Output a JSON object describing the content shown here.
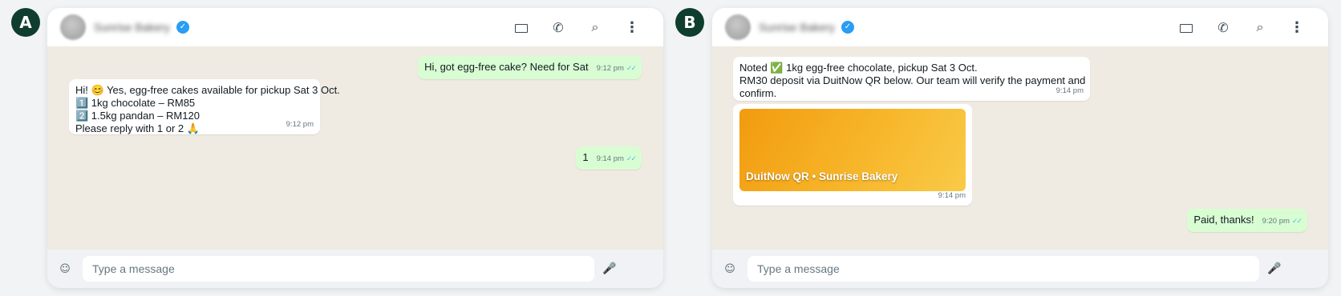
{
  "panels": [
    {
      "badge": "A",
      "contact_name": "Sunrise Bakery",
      "verified_icon": "✓",
      "header_icons": {
        "video": "",
        "call": "✆",
        "search": "⌕",
        "menu": "⋮"
      },
      "messages": [
        {
          "lines": [
            "Hi, got egg-free cake? Need for Sat"
          ],
          "time": "9:12 pm",
          "ticks": "✓✓"
        },
        {
          "lines": [
            "Hi! 😊 Yes, egg-free cakes available for pickup Sat 3 Oct.",
            "1️⃣ 1kg chocolate – RM85",
            "2️⃣ 1.5kg pandan – RM120",
            "Please reply with 1 or 2 🙏"
          ],
          "time": "9:12 pm"
        },
        {
          "lines": [
            "1"
          ],
          "time": "9:14 pm",
          "ticks": "✓✓"
        }
      ],
      "input_placeholder": "Type a message",
      "emoji_icon": "☺",
      "mic_icon": "🎤"
    },
    {
      "badge": "B",
      "contact_name": "Sunrise Bakery",
      "verified_icon": "✓",
      "header_icons": {
        "video": "",
        "call": "✆",
        "search": "⌕",
        "menu": "⋮"
      },
      "messages": [
        {
          "lines": [
            "Noted ✅ 1kg egg-free chocolate, pickup Sat 3 Oct.",
            "RM30 deposit via DuitNow QR below. Our team will verify the payment and",
            "confirm."
          ],
          "time": "9:14 pm"
        },
        {
          "qr_label": "DuitNow QR  •  Sunrise Bakery",
          "time": "9:14 pm"
        },
        {
          "lines": [
            "Paid, thanks!"
          ],
          "time": "9:20 pm",
          "ticks": "✓✓"
        }
      ],
      "input_placeholder": "Type a message",
      "emoji_icon": "☺",
      "mic_icon": "🎤"
    }
  ]
}
